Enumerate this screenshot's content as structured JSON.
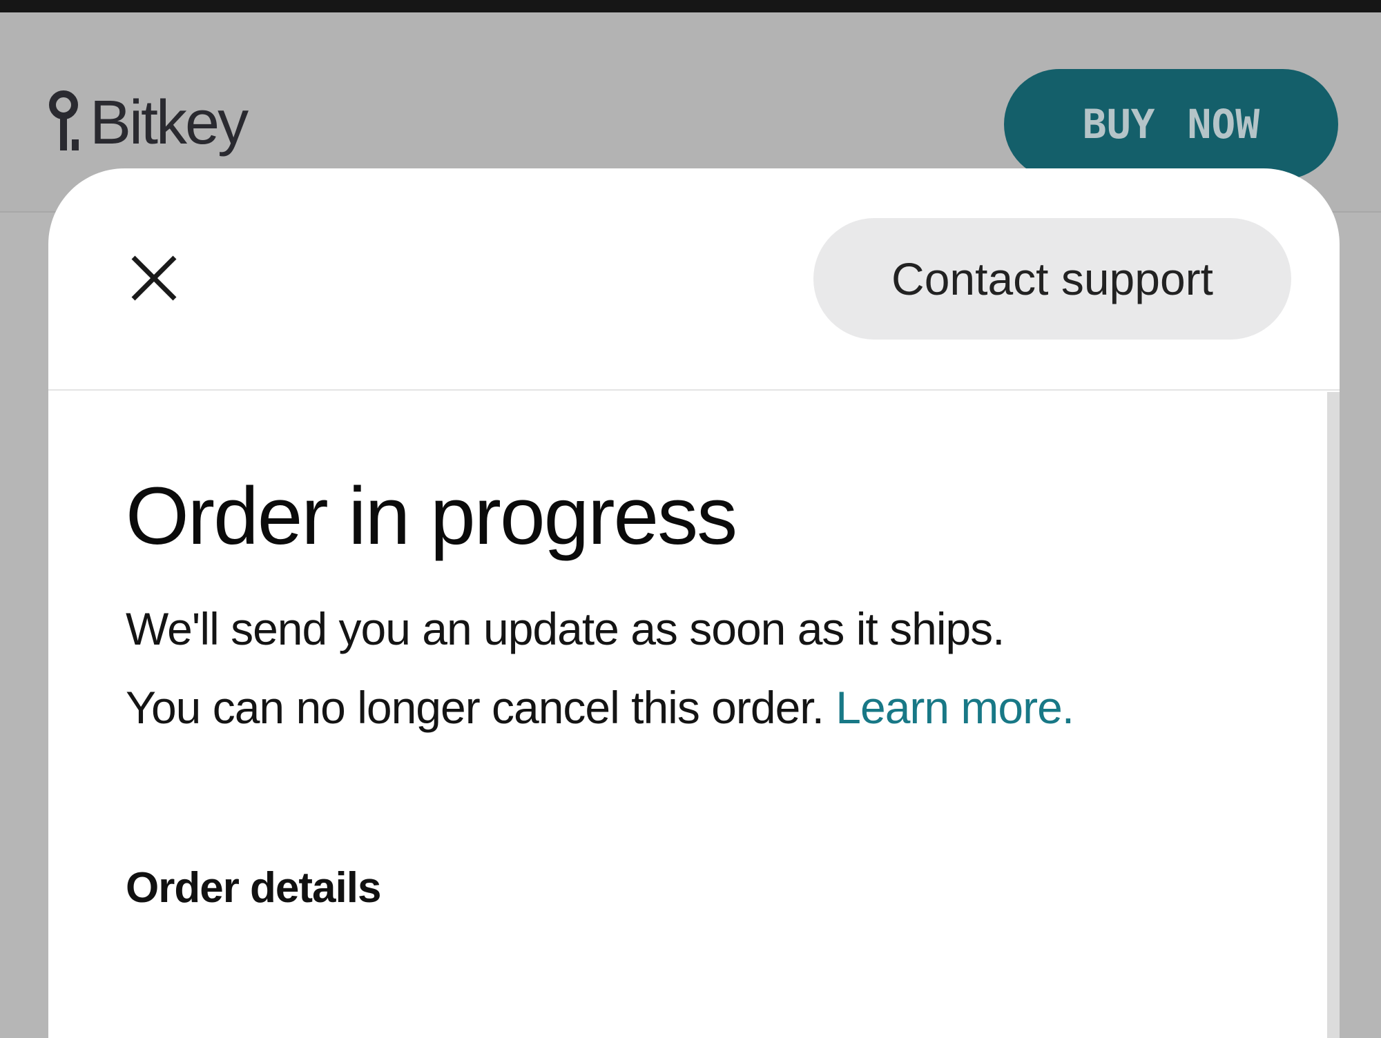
{
  "header": {
    "logo_text": "Bitkey",
    "buy_now_label": "BUY NOW",
    "brand_color": "#145f6a"
  },
  "modal": {
    "close_icon": "close-icon",
    "support_label": "Contact support",
    "title": "Order in progress",
    "message_line1": "We'll send you an update as soon as it ships.",
    "message_line2": "You can no longer cancel this order.",
    "learn_more_label": "Learn more.",
    "link_color": "#187886",
    "order_details_heading": "Order details"
  }
}
